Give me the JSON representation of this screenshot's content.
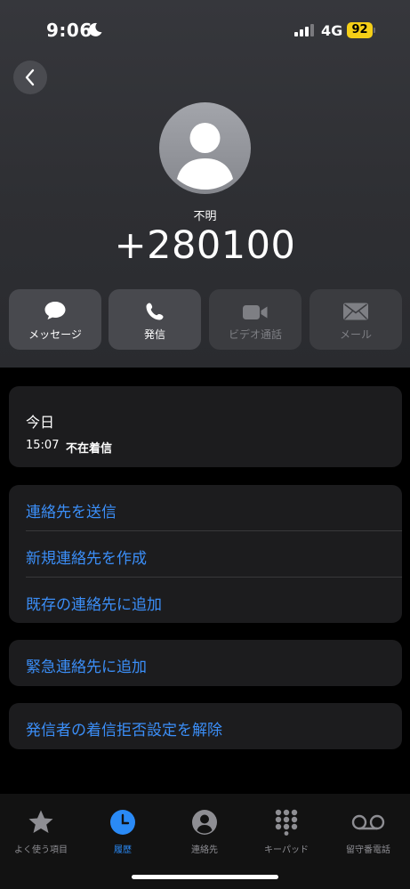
{
  "status_bar": {
    "time": "9:06",
    "network": "4G",
    "battery": "92",
    "battery_color": "#f5cf17"
  },
  "header": {
    "back_icon": "chevron-left-icon",
    "contact_label": "不明",
    "phone_number": "+280100"
  },
  "actions": [
    {
      "label": "メッセージ",
      "icon": "message-bubble-icon",
      "enabled": true
    },
    {
      "label": "発信",
      "icon": "phone-icon",
      "enabled": true
    },
    {
      "label": "ビデオ通話",
      "icon": "video-icon",
      "enabled": false
    },
    {
      "label": "メール",
      "icon": "mail-icon",
      "enabled": false
    }
  ],
  "call_history": {
    "title": "今日",
    "entries": [
      {
        "time": "15:07",
        "status": "不在着信"
      }
    ]
  },
  "options_group": [
    "連絡先を送信",
    "新規連絡先を作成",
    "既存の連絡先に追加"
  ],
  "emergency": "緊急連絡先に追加",
  "unblock": "発信者の着信拒否設定を解除",
  "accent_color": "#3b8ef7",
  "tabbar": {
    "tabs": [
      {
        "label": "よく使う項目",
        "icon": "star-icon",
        "active": false
      },
      {
        "label": "履歴",
        "icon": "clock-icon",
        "active": true
      },
      {
        "label": "連絡先",
        "icon": "person-circle-icon",
        "active": false
      },
      {
        "label": "キーパッド",
        "icon": "keypad-icon",
        "active": false
      },
      {
        "label": "留守番電話",
        "icon": "voicemail-icon",
        "active": false
      }
    ]
  }
}
